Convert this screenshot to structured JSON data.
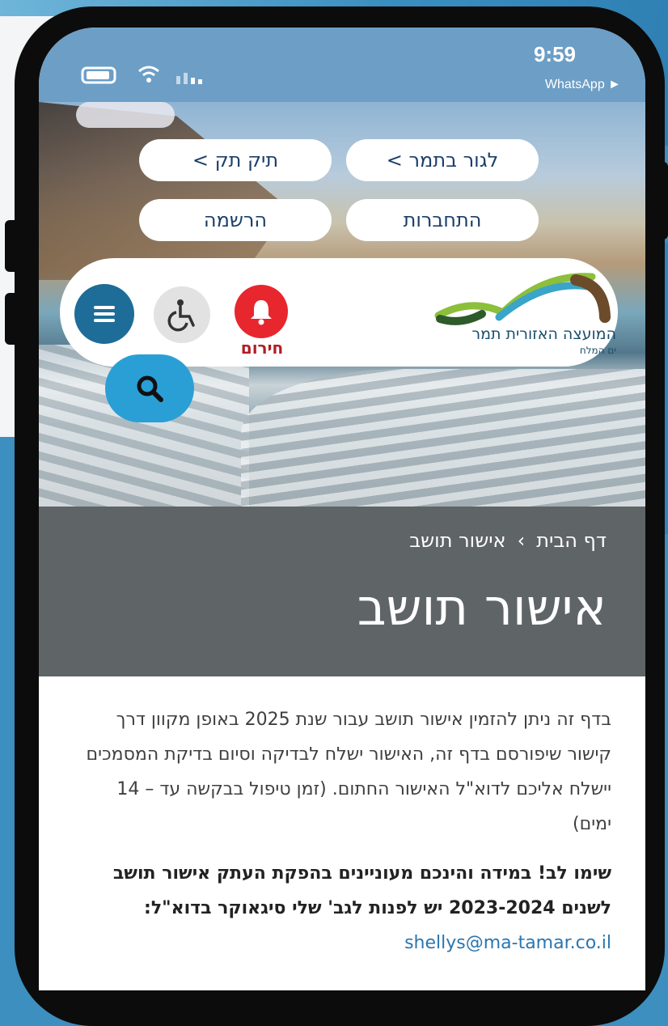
{
  "status_bar": {
    "time": "9:59",
    "return_app": "WhatsApp ►"
  },
  "header": {
    "nav_buttons": [
      {
        "label": "לגור בתמר >"
      },
      {
        "label": "תיק תק >"
      },
      {
        "label": "התחברות"
      },
      {
        "label": "הרשמה"
      }
    ],
    "logo": {
      "name": "המועצה האזורית תמר",
      "subtitle": "ים המלח"
    },
    "alarm_label": "חירום",
    "colors": {
      "menu": "#1e6c98",
      "alarm": "#e8262e",
      "search": "#2a9fd6"
    }
  },
  "breadcrumb": {
    "home": "דף הבית",
    "separator": "›",
    "current": "אישור תושב"
  },
  "page_title": "אישור תושב",
  "content": {
    "paragraph1": "בדף זה ניתן להזמין אישור תושב עבור שנת 2025 באופן מקוון דרך קישור שיפורסם בדף זה, האישור ישלח לבדיקה וסיום בדיקת המסמכים יישלח אליכם לדוא\"ל האישור החתום. (זמן טיפול בבקשה עד – 14 ימים)",
    "paragraph2_bold": "שימו לב! במידה והינכם מעוניינים בהפקת העתק אישור תושב לשנים 2023-2024 יש לפנות לגב' שלי סיגאוקר בדוא\"ל:",
    "email": "shellys@ma-tamar.co.il"
  }
}
